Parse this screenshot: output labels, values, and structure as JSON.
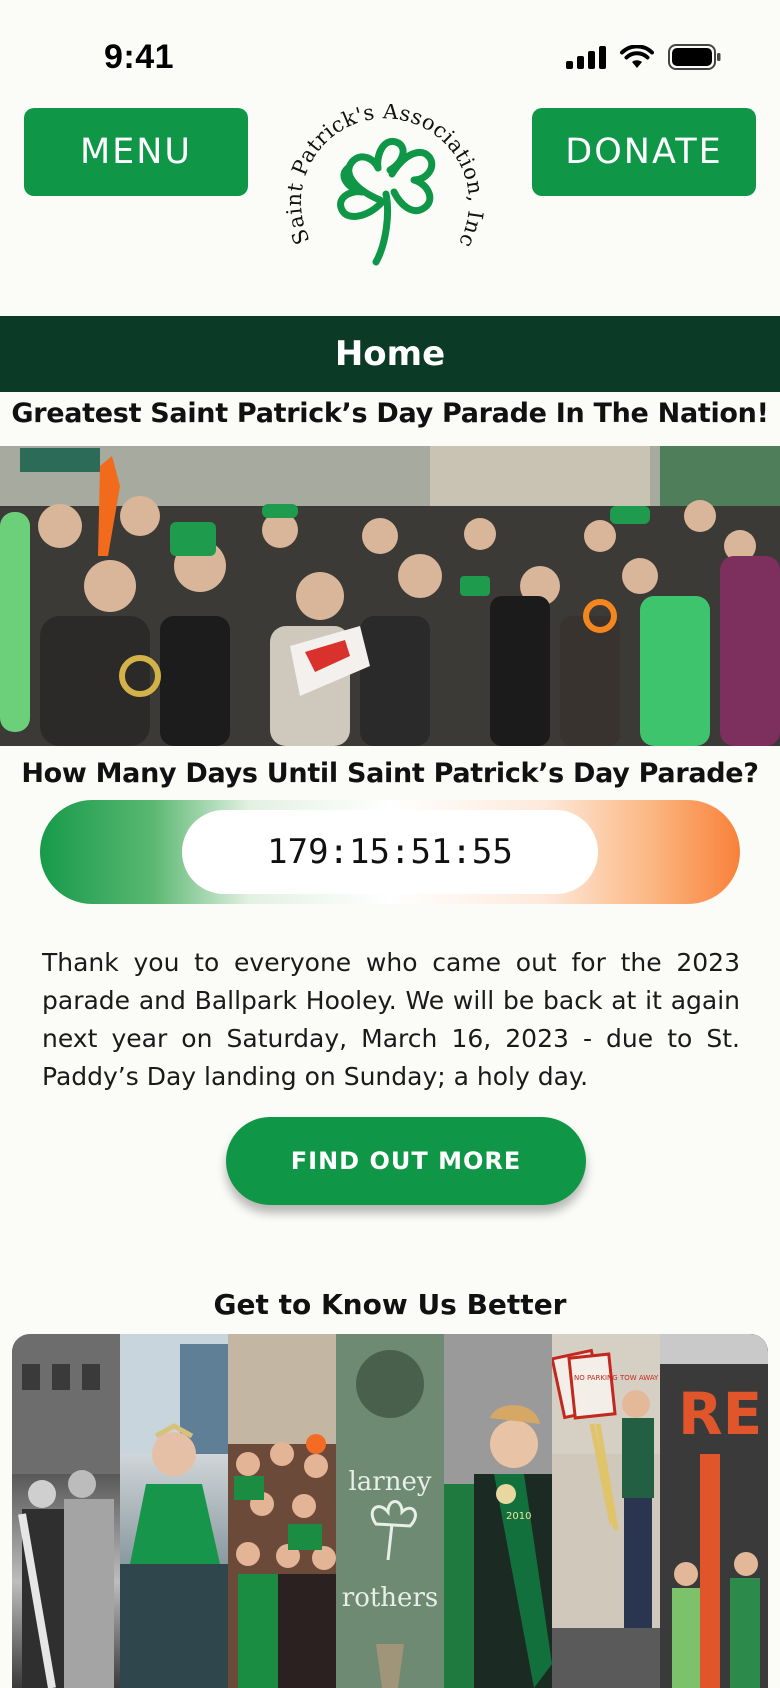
{
  "status_bar": {
    "time": "9:41"
  },
  "header": {
    "menu_label": "MENU",
    "donate_label": "DONATE",
    "logo_text": "Saint Patrick's Association, Inc."
  },
  "page_title": "Home",
  "tagline": "Greatest Saint Patrick’s Day Parade In The Nation!",
  "hero": {
    "alt": "Parade crowd photo"
  },
  "countdown": {
    "title": "How Many Days Until Saint Patrick’s Day Parade?",
    "days": "179",
    "hours": "15",
    "minutes": "51",
    "seconds": "55",
    "separator": ":"
  },
  "announcement": "Thank you to everyone who came out for the 2023 parade and Ballpark Hooley. We will be back at it again next year on Saturday, March 16, 2023 - due to St. Paddy’s Day landing on Sunday; a holy day.",
  "cta_label": "FIND OUT MORE",
  "about": {
    "heading": "Get to Know Us Better",
    "strips": [
      {
        "name": "history-photo"
      },
      {
        "name": "queen-photo"
      },
      {
        "name": "group-photo"
      },
      {
        "name": "blarney-brothers-photo",
        "text_top": "larney",
        "text_bottom": "rothers"
      },
      {
        "name": "sash-photo",
        "text": "2010"
      },
      {
        "name": "no-parking-photo",
        "text": "NO PARKING TOW AWAY ZONE"
      },
      {
        "name": "restaurant-photo",
        "text": "RE"
      }
    ]
  },
  "colors": {
    "brand_green": "#0f9647",
    "dark_green": "#0b3a26",
    "orange": "#f9813a"
  }
}
